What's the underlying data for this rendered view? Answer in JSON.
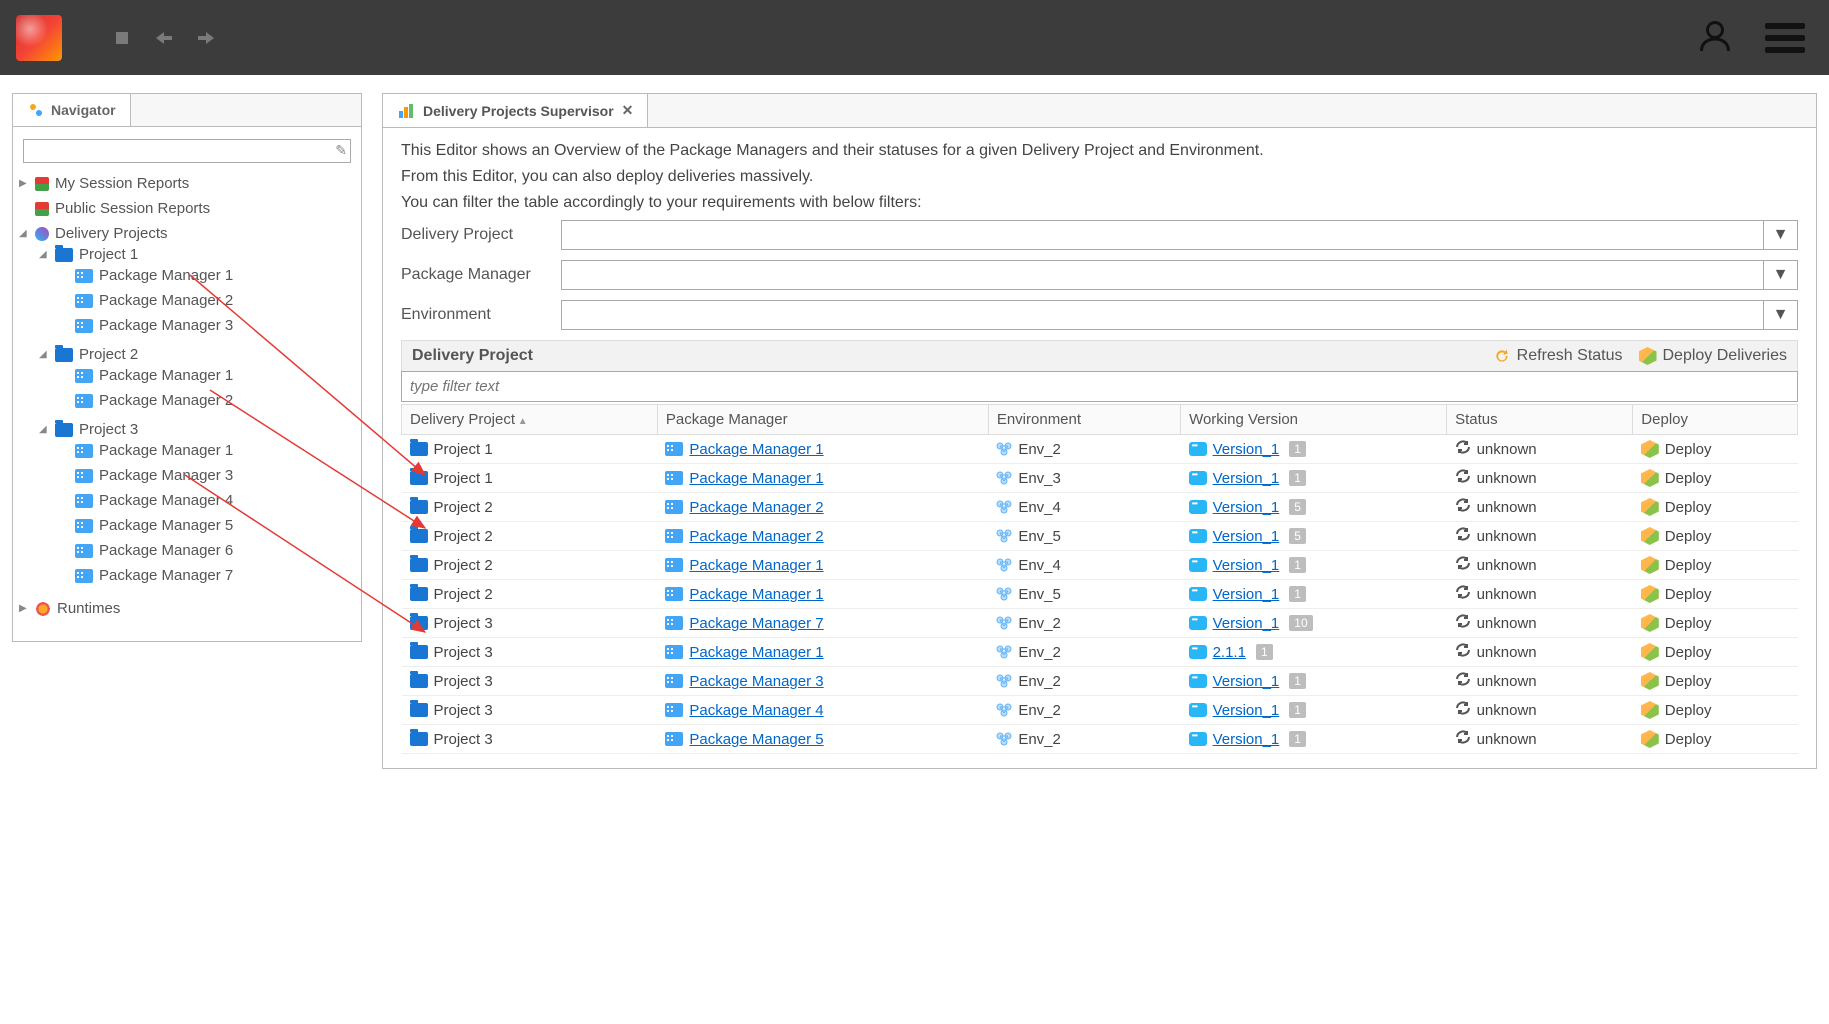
{
  "toolbar": {},
  "navigator": {
    "title": "Navigator",
    "search_placeholder": "",
    "items": {
      "my_session": "My Session Reports",
      "public_session": "Public Session Reports",
      "delivery_projects": "Delivery Projects",
      "runtimes": "Runtimes"
    },
    "projects": [
      {
        "name": "Project 1",
        "managers": [
          "Package Manager 1",
          "Package Manager 2",
          "Package Manager 3"
        ]
      },
      {
        "name": "Project 2",
        "managers": [
          "Package Manager 1",
          "Package Manager 2"
        ]
      },
      {
        "name": "Project 3",
        "managers": [
          "Package Manager 1",
          "Package Manager 3",
          "Package Manager 4",
          "Package Manager 5",
          "Package Manager 6",
          "Package Manager 7"
        ]
      }
    ]
  },
  "editor": {
    "tab_title": "Delivery Projects Supervisor",
    "desc_line1": "This Editor shows an Overview of the Package Managers and their statuses for a given Delivery Project and Environment.",
    "desc_line2": "From this Editor, you can also deploy deliveries massively.",
    "desc_line3": "You can filter the table accordingly to your requirements with below filters:",
    "filters": {
      "delivery_project_label": "Delivery Project",
      "package_manager_label": "Package Manager",
      "environment_label": "Environment"
    },
    "section_title": "Delivery Project",
    "refresh_label": "Refresh Status",
    "deploy_label": "Deploy Deliveries",
    "table_filter_placeholder": "type filter text",
    "columns": {
      "project": "Delivery Project",
      "manager": "Package Manager",
      "environment": "Environment",
      "version": "Working Version",
      "status": "Status",
      "deploy": "Deploy"
    },
    "rows": [
      {
        "project": "Project 1",
        "manager": "Package Manager 1",
        "env": "Env_2",
        "version": "Version_1",
        "badge": "1",
        "status": "unknown",
        "deploy": "Deploy"
      },
      {
        "project": "Project 1",
        "manager": "Package Manager 1",
        "env": "Env_3",
        "version": "Version_1",
        "badge": "1",
        "status": "unknown",
        "deploy": "Deploy"
      },
      {
        "project": "Project 2",
        "manager": "Package Manager 2",
        "env": "Env_4",
        "version": "Version_1",
        "badge": "5",
        "status": "unknown",
        "deploy": "Deploy"
      },
      {
        "project": "Project 2",
        "manager": "Package Manager 2",
        "env": "Env_5",
        "version": "Version_1",
        "badge": "5",
        "status": "unknown",
        "deploy": "Deploy"
      },
      {
        "project": "Project 2",
        "manager": "Package Manager 1",
        "env": "Env_4",
        "version": "Version_1",
        "badge": "1",
        "status": "unknown",
        "deploy": "Deploy"
      },
      {
        "project": "Project 2",
        "manager": "Package Manager 1",
        "env": "Env_5",
        "version": "Version_1",
        "badge": "1",
        "status": "unknown",
        "deploy": "Deploy"
      },
      {
        "project": "Project 3",
        "manager": "Package Manager 7",
        "env": "Env_2",
        "version": "Version_1",
        "badge": "10",
        "status": "unknown",
        "deploy": "Deploy"
      },
      {
        "project": "Project 3",
        "manager": "Package Manager 1",
        "env": "Env_2",
        "version": "2.1.1",
        "badge": "1",
        "status": "unknown",
        "deploy": "Deploy"
      },
      {
        "project": "Project 3",
        "manager": "Package Manager 3",
        "env": "Env_2",
        "version": "Version_1",
        "badge": "1",
        "status": "unknown",
        "deploy": "Deploy"
      },
      {
        "project": "Project 3",
        "manager": "Package Manager 4",
        "env": "Env_2",
        "version": "Version_1",
        "badge": "1",
        "status": "unknown",
        "deploy": "Deploy"
      },
      {
        "project": "Project 3",
        "manager": "Package Manager 5",
        "env": "Env_2",
        "version": "Version_1",
        "badge": "1",
        "status": "unknown",
        "deploy": "Deploy"
      }
    ]
  }
}
